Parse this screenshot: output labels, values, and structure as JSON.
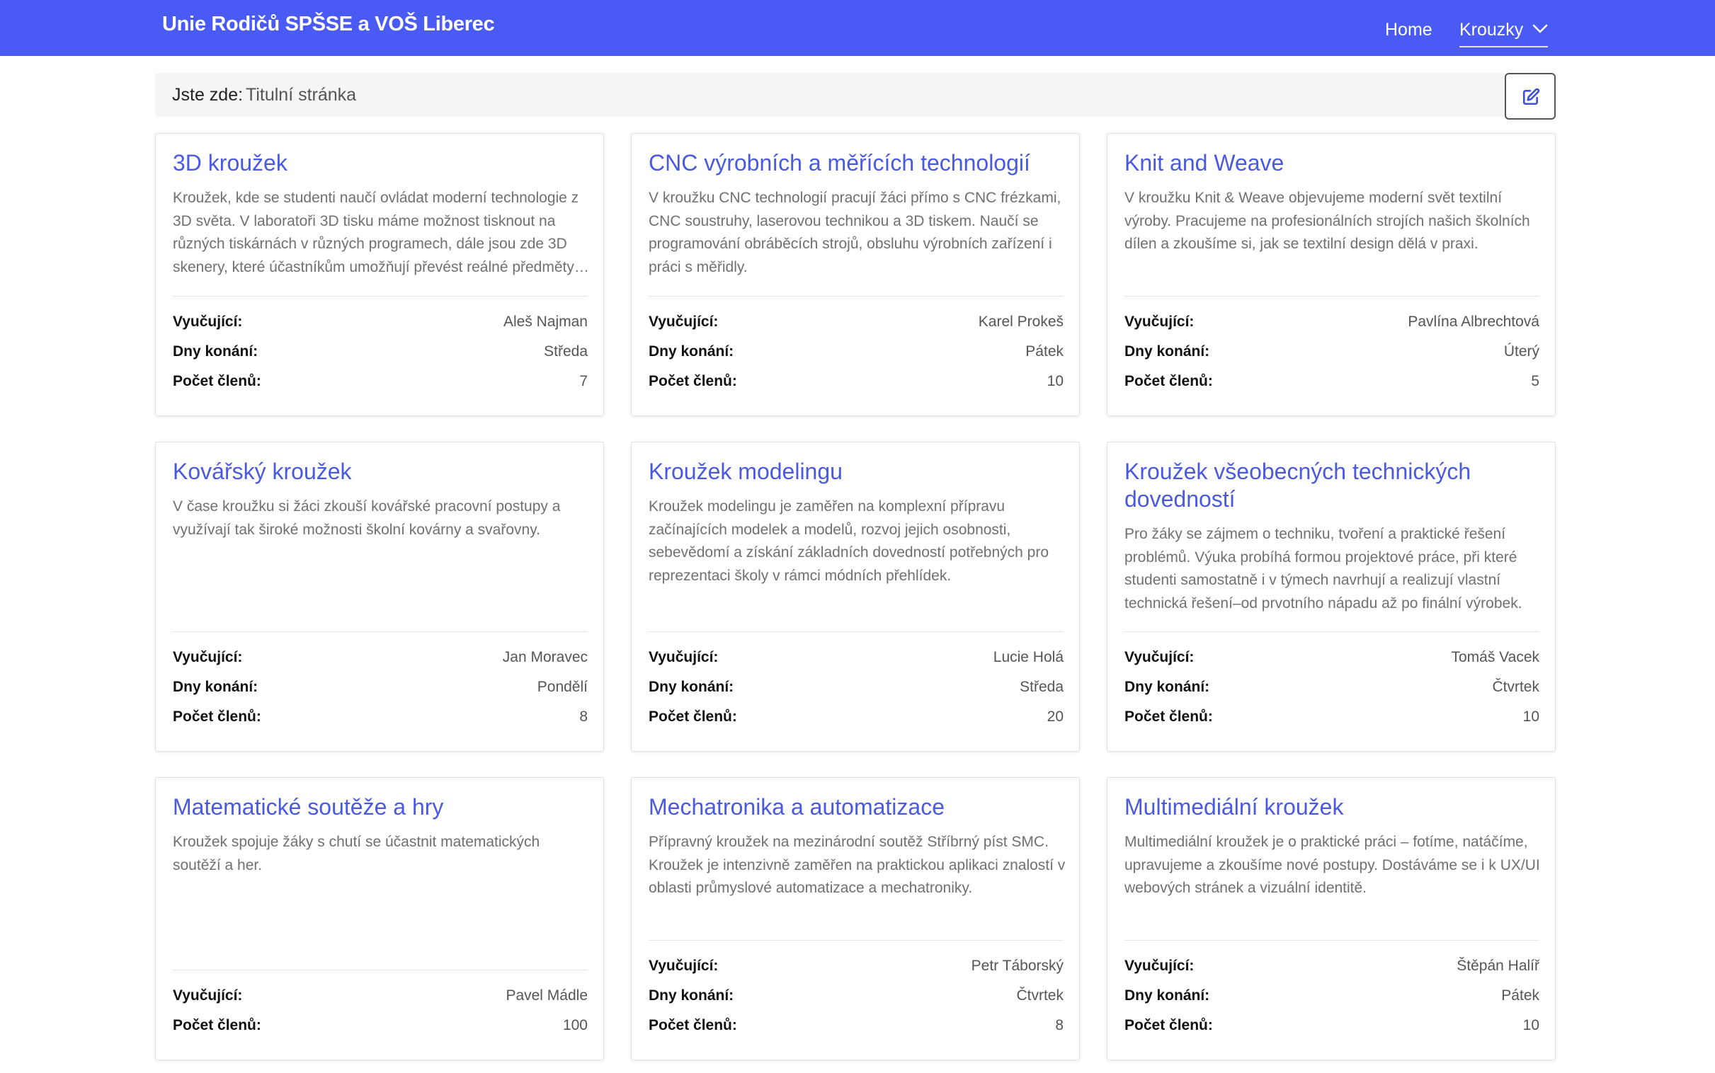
{
  "navbar": {
    "brand": "Unie Rodičů SPŠSE a VOŠ Liberec",
    "links": {
      "home": "Home",
      "krouzky": "Krouzky"
    }
  },
  "breadcrumb": {
    "label": "Jste zde:",
    "current": "Titulní stránka"
  },
  "labels": {
    "teacher": "Vyučující:",
    "days": "Dny konání:",
    "members": "Počet členů:"
  },
  "cards": [
    {
      "title": "3D kroužek",
      "description": "Kroužek, kde se studenti naučí ovládat moderní technologie z 3D světa. V laboratoři 3D tisku máme možnost tisknout na různých tiskárnách v různých programech, dále jsou zde 3D skenery, které účastníkům umožňují převést reálné předměty do digitální podoby.",
      "teacher": "Aleš Najman",
      "days": "Středa",
      "members": "7"
    },
    {
      "title": "CNC výrobních a měřících technologií",
      "description": "V kroužku CNC technologií pracují žáci přímo s CNC frézkami, CNC soustruhy, laserovou technikou a 3D tiskem. Naučí se programování obráběcích strojů, obsluhu výrobních zařízení i práci s měřidly.",
      "teacher": "Karel Prokeš",
      "days": "Pátek",
      "members": "10"
    },
    {
      "title": "Knit and Weave",
      "description": "V kroužku Knit & Weave objevujeme moderní svět textilní výroby. Pracujeme na profesionálních strojích našich školních dílen a zkoušíme si, jak se textilní design dělá v praxi.",
      "teacher": "Pavlína Albrechtová",
      "days": "Úterý",
      "members": "5"
    },
    {
      "title": "Kovářský kroužek",
      "description": "V čase kroužku si žáci zkouší kovářské pracovní postupy a využívají tak široké možnosti školní kovárny a svařovny.",
      "teacher": "Jan Moravec",
      "days": "Pondělí",
      "members": "8"
    },
    {
      "title": "Kroužek modelingu",
      "description": "Kroužek modelingu je zaměřen na komplexní přípravu začínajících modelek a modelů, rozvoj jejich osobnosti, sebevědomí a získání základních dovedností potřebných pro reprezentaci školy v rámci módních přehlídek.",
      "teacher": "Lucie Holá",
      "days": "Středa",
      "members": "20"
    },
    {
      "title": "Kroužek všeobecných technických dovedností",
      "description": "Pro žáky se zájmem o techniku, tvoření a praktické řešení problémů. Výuka probíhá formou projektové práce, při které studenti samostatně i v týmech navrhují a realizují vlastní technická řešení–od prvotního nápadu až po finální výrobek.",
      "teacher": "Tomáš Vacek",
      "days": "Čtvrtek",
      "members": "10"
    },
    {
      "title": "Matematické soutěže a hry",
      "description": "Kroužek spojuje žáky s chutí se účastnit matematických soutěží a her.",
      "teacher": "Pavel Mádle",
      "days": "",
      "members": "100"
    },
    {
      "title": "Mechatronika a automatizace",
      "description": "Přípravný kroužek na mezinárodní soutěž Stříbrný píst SMC. Kroužek je intenzivně zaměřen na praktickou aplikaci znalostí v oblasti průmyslové automatizace a mechatroniky.",
      "teacher": "Petr Táborský",
      "days": "Čtvrtek",
      "members": "8"
    },
    {
      "title": "Multimediální kroužek",
      "description": "Multimediální kroužek je o praktické práci – fotíme, natáčíme, upravujeme a zkoušíme nové postupy. Dostáváme se i k UX/UI webových stránek a vizuální identitě.",
      "teacher": "Štěpán Halíř",
      "days": "Pátek",
      "members": "10"
    }
  ]
}
